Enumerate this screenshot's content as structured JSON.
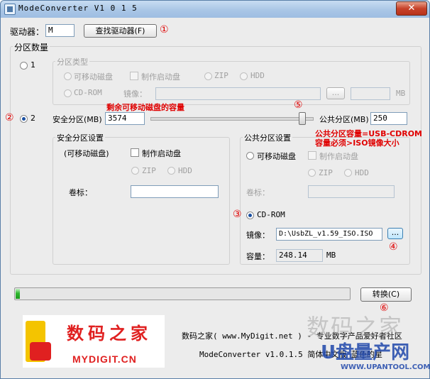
{
  "window": {
    "title": "ModeConverter V1 0 1 5",
    "close_glyph": "✕"
  },
  "drive": {
    "label": "驱动器：",
    "value": "M",
    "find_button": "查找驱动器(F)",
    "marker": "①"
  },
  "partition_count": {
    "title": "分区数量",
    "option1": {
      "label": "1",
      "selected": false
    },
    "option2": {
      "label": "2",
      "selected": true,
      "marker": "②"
    }
  },
  "partition_type": {
    "title": "分区类型",
    "removable": "可移动磁盘",
    "make_boot": "制作启动盘",
    "zip": "ZIP",
    "hdd": "HDD",
    "cdrom": "CD-ROM",
    "image_label": "镜像：",
    "browse": "...",
    "unit": "MB"
  },
  "split": {
    "safe_label": "安全分区(MB)",
    "safe_value": "3574",
    "annotation_remaining": "剩余可移动磁盘的容量",
    "slider_marker": "⑤",
    "slider_position_fraction": 0.935,
    "public_label": "公共分区(MB)",
    "public_value": "250"
  },
  "safe_settings": {
    "title": "安全分区设置",
    "type_text": "(可移动磁盘)",
    "make_boot": "制作启动盘",
    "zip": "ZIP",
    "hdd": "HDD",
    "volume_label": "卷标：",
    "volume_value": ""
  },
  "public_settings": {
    "title": "公共分区设置",
    "annotation_line1": "公共分区容量=USB-CDROM",
    "annotation_line2": "容量必须>ISO镜像大小",
    "removable": "可移动磁盘",
    "make_boot": "制作启动盘",
    "zip": "ZIP",
    "hdd": "HDD",
    "volume_label": "卷标：",
    "cdrom_marker": "③",
    "cdrom": "CD-ROM",
    "image_label": "镜像：",
    "image_value": "D:\\UsbZL_v1.59_ISO.ISO",
    "browse": "...",
    "browse_marker": "④",
    "capacity_label": "容量：",
    "capacity_value": "248.14",
    "capacity_unit": "MB"
  },
  "progress": {
    "fraction": 0.012
  },
  "convert": {
    "label": "转换(C)",
    "marker": "⑥"
  },
  "footer": {
    "logo_text": "数码之家",
    "logo_url": "MYDIGIT.CN",
    "line1": "数码之家( www.MyDigit.net ) - 专业数字产品爱好者社区",
    "line2": "ModeConverter v1.0.1.5 简体中文版 蓝色的星"
  },
  "watermark": {
    "text1": "数码之家",
    "text2": "U盘量产网",
    "text3": "WWW.UPANTOOL.COM"
  },
  "colors": {
    "annotation_red": "#e00000",
    "title_blue": "#a9c6e6",
    "progress_green": "#2fb82f",
    "logo_red": "#e02020"
  }
}
